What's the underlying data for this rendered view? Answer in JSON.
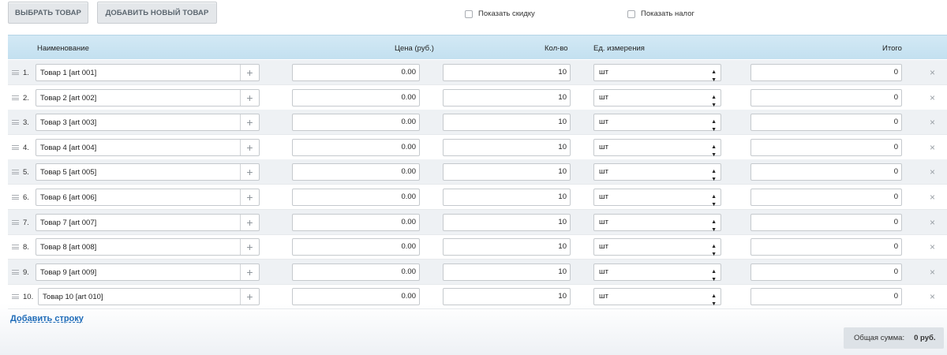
{
  "toolbar": {
    "select_label": "ВЫБРАТЬ ТОВАР",
    "add_new_label": "ДОБАВИТЬ НОВЫЙ ТОВАР",
    "show_discount_label": "Показать скидку",
    "show_tax_label": "Показать налог"
  },
  "table": {
    "headers": {
      "name": "Наименование",
      "price": "Цена (руб.)",
      "qty": "Кол-во",
      "unit": "Ед. измерения",
      "total": "Итого"
    },
    "rows": [
      {
        "num": "1.",
        "name": "Товар 1  [art 001]",
        "price": "0.00",
        "qty": "10",
        "unit": "шт",
        "total": "0"
      },
      {
        "num": "2.",
        "name": "Товар 2  [art 002]",
        "price": "0.00",
        "qty": "10",
        "unit": "шт",
        "total": "0"
      },
      {
        "num": "3.",
        "name": "Товар 3 [art 003]",
        "price": "0.00",
        "qty": "10",
        "unit": "шт",
        "total": "0"
      },
      {
        "num": "4.",
        "name": "Товар 4 [art 004]",
        "price": "0.00",
        "qty": "10",
        "unit": "шт",
        "total": "0"
      },
      {
        "num": "5.",
        "name": "Товар 5 [art 005]",
        "price": "0.00",
        "qty": "10",
        "unit": "шт",
        "total": "0"
      },
      {
        "num": "6.",
        "name": "Товар 6 [art 006]",
        "price": "0.00",
        "qty": "10",
        "unit": "шт",
        "total": "0"
      },
      {
        "num": "7.",
        "name": "Товар 7 [art 007]",
        "price": "0.00",
        "qty": "10",
        "unit": "шт",
        "total": "0"
      },
      {
        "num": "8.",
        "name": "Товар 8 [art 008]",
        "price": "0.00",
        "qty": "10",
        "unit": "шт",
        "total": "0"
      },
      {
        "num": "9.",
        "name": "Товар 9 [art 009]",
        "price": "0.00",
        "qty": "10",
        "unit": "шт",
        "total": "0"
      },
      {
        "num": "10.",
        "name": "Товар 10 [art 010]",
        "price": "0.00",
        "qty": "10",
        "unit": "шт",
        "total": "0"
      }
    ]
  },
  "add_row_label": "Добавить строку",
  "summary": {
    "label": "Общая сумма:",
    "value": "0 руб."
  },
  "icons": {
    "plus": "+",
    "delete": "×",
    "select_arrows": "▲▼"
  }
}
